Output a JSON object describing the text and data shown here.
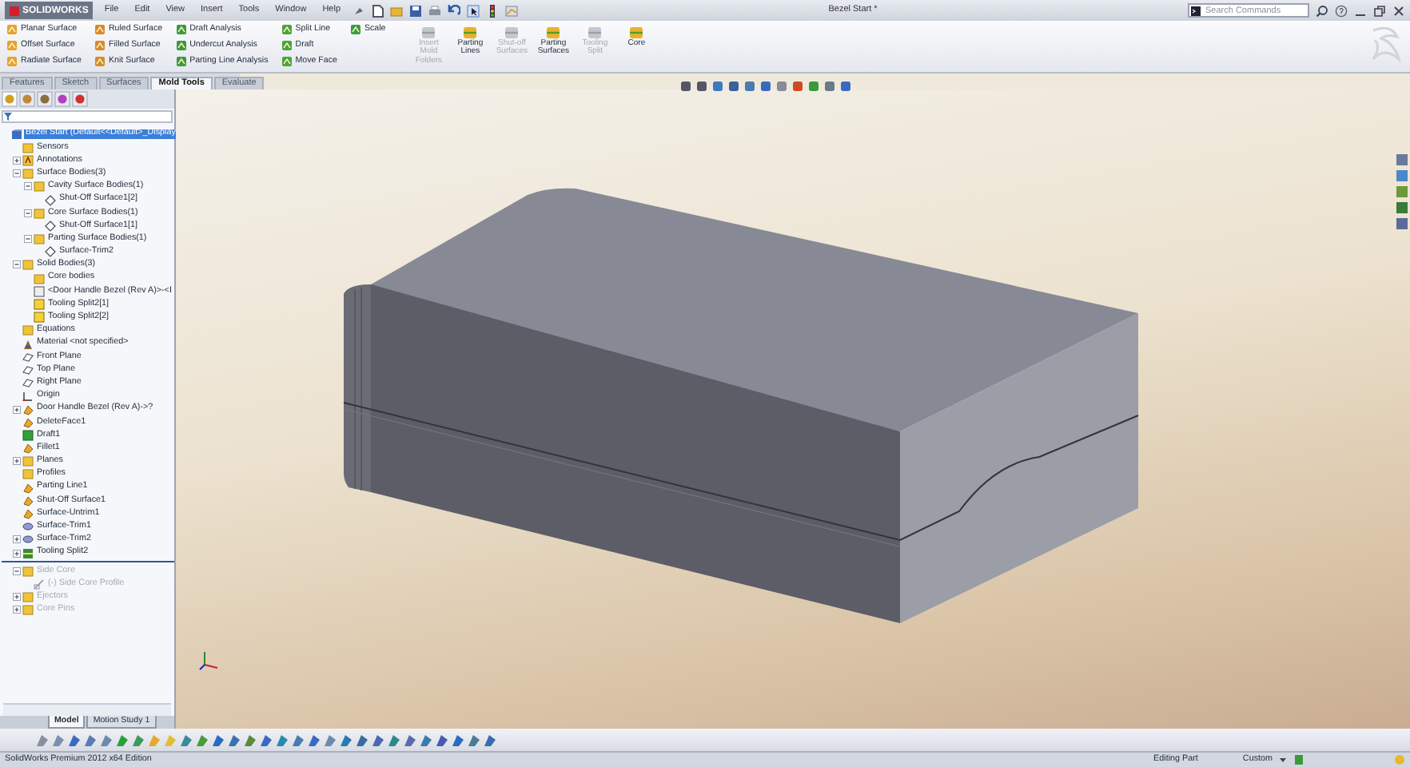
{
  "window": {
    "logo": "SOLIDWORKS",
    "title": "Bezel Start *"
  },
  "menu": [
    "File",
    "Edit",
    "View",
    "Insert",
    "Tools",
    "Window",
    "Help"
  ],
  "search": {
    "placeholder": "Search Commands"
  },
  "ribbon": {
    "columns": [
      [
        {
          "label": "Planar Surface"
        },
        {
          "label": "Offset Surface"
        },
        {
          "label": "Radiate Surface"
        }
      ],
      [
        {
          "label": "Ruled Surface"
        },
        {
          "label": "Filled Surface"
        },
        {
          "label": "Knit Surface"
        }
      ],
      [
        {
          "label": "Draft Analysis"
        },
        {
          "label": "Undercut Analysis"
        },
        {
          "label": "Parting Line Analysis"
        }
      ],
      [
        {
          "label": "Split Line"
        },
        {
          "label": "Draft"
        },
        {
          "label": "Move Face"
        }
      ],
      [
        {
          "label": "Scale"
        }
      ]
    ],
    "large": [
      {
        "label": "Insert Mold Folders",
        "disabled": true
      },
      {
        "label": "Parting Lines",
        "disabled": false
      },
      {
        "label": "Shut-off Surfaces",
        "disabled": true
      },
      {
        "label": "Parting Surfaces",
        "disabled": false
      },
      {
        "label": "Tooling Split",
        "disabled": true
      },
      {
        "label": "Core",
        "disabled": false
      }
    ]
  },
  "tabs": [
    {
      "label": "Features",
      "selected": false
    },
    {
      "label": "Sketch",
      "selected": false
    },
    {
      "label": "Surfaces",
      "selected": false
    },
    {
      "label": "Mold Tools",
      "selected": true
    },
    {
      "label": "Evaluate",
      "selected": false
    }
  ],
  "tree": {
    "root": {
      "label": "Bezel Start  (Default<<Default>_Display",
      "kind": "part",
      "selected": true
    },
    "items": [
      {
        "label": "Sensors",
        "kind": "folder",
        "selected": false
      },
      {
        "label": "Annotations",
        "kind": "annotation",
        "selected": false,
        "expanded": false
      },
      {
        "label": "Surface Bodies(3)",
        "kind": "folder",
        "selected": false,
        "expanded": true,
        "children": [
          {
            "label": "Cavity Surface Bodies(1)",
            "kind": "folder",
            "selected": false,
            "expanded": true,
            "children": [
              {
                "label": "Shut-Off Surface1[2]",
                "kind": "surface",
                "selected": false
              }
            ]
          },
          {
            "label": "Core Surface Bodies(1)",
            "kind": "folder",
            "selected": false,
            "expanded": true,
            "children": [
              {
                "label": "Shut-Off Surface1[1]",
                "kind": "surface",
                "selected": false
              }
            ]
          },
          {
            "label": "Parting Surface Bodies(1)",
            "kind": "folder",
            "selected": false,
            "expanded": true,
            "children": [
              {
                "label": "Surface-Trim2",
                "kind": "surface",
                "selected": false
              }
            ]
          }
        ]
      },
      {
        "label": "Solid Bodies(3)",
        "kind": "folder",
        "selected": false,
        "expanded": true,
        "children": [
          {
            "label": "Core bodies",
            "kind": "folder",
            "selected": false
          },
          {
            "label": "<Door Handle Bezel (Rev A)>-<I",
            "kind": "body",
            "selected": false
          },
          {
            "label": "Tooling Split2[1]",
            "kind": "solid",
            "selected": false
          },
          {
            "label": "Tooling Split2[2]",
            "kind": "solid",
            "selected": false
          }
        ]
      },
      {
        "label": "Equations",
        "kind": "folder",
        "selected": false
      },
      {
        "label": "Material <not specified>",
        "kind": "material",
        "selected": false
      },
      {
        "label": "Front Plane",
        "kind": "plane",
        "selected": false
      },
      {
        "label": "Top Plane",
        "kind": "plane",
        "selected": false
      },
      {
        "label": "Right Plane",
        "kind": "plane",
        "selected": false
      },
      {
        "label": "Origin",
        "kind": "origin",
        "selected": false
      },
      {
        "label": "Door Handle Bezel (Rev A)->?",
        "kind": "feature",
        "selected": false,
        "expanded": false
      },
      {
        "label": "DeleteFace1",
        "kind": "feature",
        "selected": false
      },
      {
        "label": "Draft1",
        "kind": "draft",
        "selected": false
      },
      {
        "label": "Fillet1",
        "kind": "feature",
        "selected": false
      },
      {
        "label": "Planes",
        "kind": "folder",
        "selected": false,
        "expanded": false
      },
      {
        "label": "Profiles",
        "kind": "folder",
        "selected": false
      },
      {
        "label": "Parting Line1",
        "kind": "feature",
        "selected": false
      },
      {
        "label": "Shut-Off Surface1",
        "kind": "feature",
        "selected": false
      },
      {
        "label": "Surface-Untrim1",
        "kind": "feature",
        "selected": false
      },
      {
        "label": "Surface-Trim1",
        "kind": "trim",
        "selected": false
      },
      {
        "label": "Surface-Trim2",
        "kind": "trim",
        "selected": false,
        "expanded": false
      },
      {
        "label": "Tooling Split2",
        "kind": "split",
        "selected": false,
        "expanded": false
      }
    ],
    "rolled_back": [
      {
        "label": "Side Core",
        "kind": "folder",
        "selected": false,
        "expanded": true,
        "children": [
          {
            "label": "(-) Side Core Profile",
            "kind": "sketch",
            "selected": false
          }
        ]
      },
      {
        "label": "Ejectors",
        "kind": "folder",
        "selected": false,
        "expanded": false
      },
      {
        "label": "Core Pins",
        "kind": "folder",
        "selected": false,
        "expanded": false
      }
    ]
  },
  "model_tabs": [
    {
      "label": "Model",
      "selected": true
    },
    {
      "label": "Motion Study 1",
      "selected": false
    }
  ],
  "status_bar": {
    "edition": "SolidWorks Premium 2012 x64 Edition",
    "mode": "Editing Part",
    "units": "Custom"
  }
}
